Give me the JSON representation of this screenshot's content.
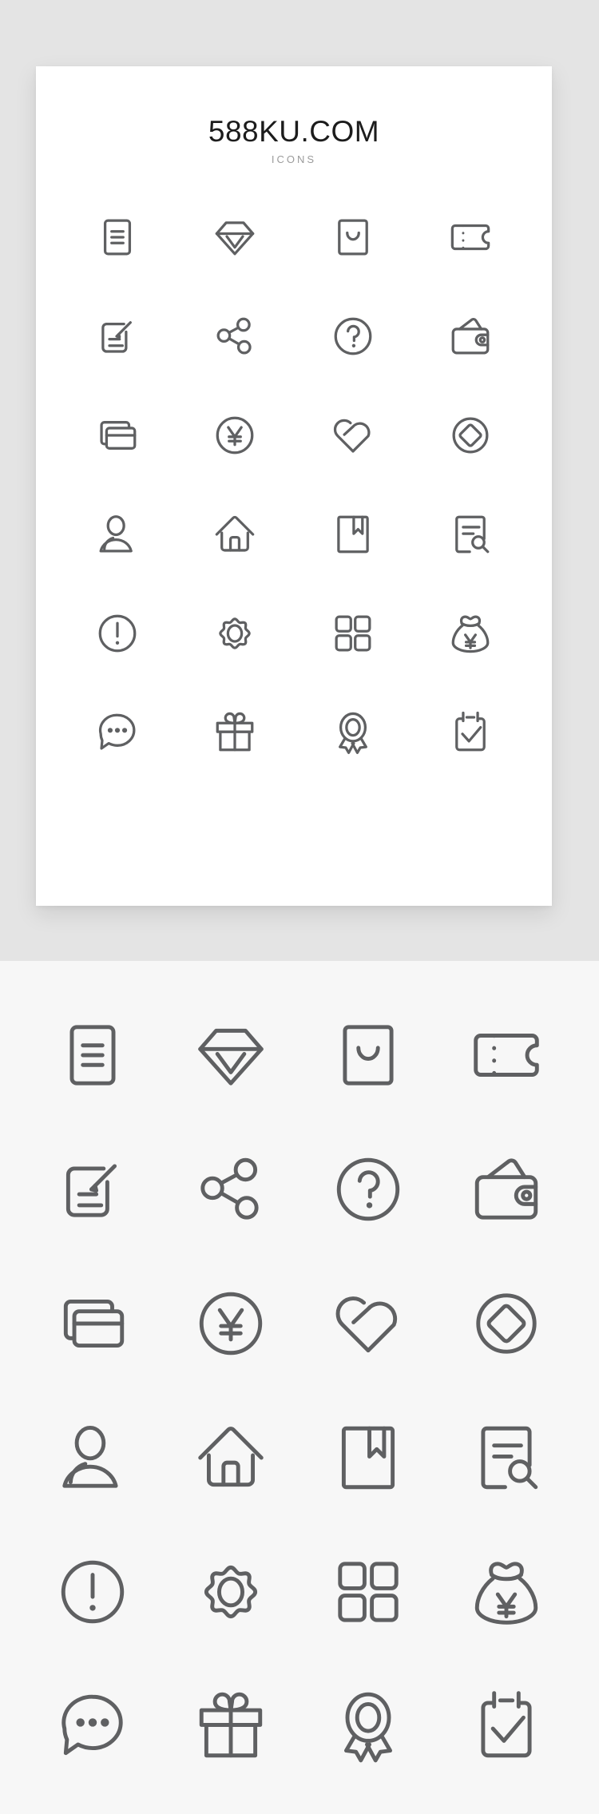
{
  "page": {
    "background_color": "#e4e4e4",
    "card_background": "#ffffff",
    "section2_background": "#f7f7f7",
    "icon_stroke_color": "#5f6062"
  },
  "header": {
    "title": "588KU.COM",
    "subtitle": "ICONS"
  },
  "icons": [
    {
      "key": "document",
      "label": "document-icon"
    },
    {
      "key": "diamond",
      "label": "diamond-icon"
    },
    {
      "key": "shopping-bag",
      "label": "shopping-bag-icon"
    },
    {
      "key": "ticket",
      "label": "ticket-icon"
    },
    {
      "key": "edit-document",
      "label": "edit-document-icon"
    },
    {
      "key": "share",
      "label": "share-icon"
    },
    {
      "key": "question",
      "label": "question-mark-icon"
    },
    {
      "key": "wallet",
      "label": "wallet-icon"
    },
    {
      "key": "cards",
      "label": "bank-cards-icon"
    },
    {
      "key": "yen-circle",
      "label": "yen-coin-icon"
    },
    {
      "key": "heart-check",
      "label": "heart-check-icon"
    },
    {
      "key": "coin-diamond",
      "label": "coin-diamond-icon"
    },
    {
      "key": "user",
      "label": "user-icon"
    },
    {
      "key": "home",
      "label": "home-icon"
    },
    {
      "key": "bookmark-box",
      "label": "bookmark-box-icon"
    },
    {
      "key": "document-search",
      "label": "document-search-icon"
    },
    {
      "key": "alert",
      "label": "exclamation-circle-icon"
    },
    {
      "key": "settings",
      "label": "settings-gear-icon"
    },
    {
      "key": "grid",
      "label": "grid-apps-icon"
    },
    {
      "key": "money-bag",
      "label": "money-bag-icon"
    },
    {
      "key": "chat",
      "label": "chat-bubble-icon"
    },
    {
      "key": "gift",
      "label": "gift-box-icon"
    },
    {
      "key": "medal",
      "label": "award-medal-icon"
    },
    {
      "key": "checklist",
      "label": "clipboard-check-icon"
    }
  ]
}
